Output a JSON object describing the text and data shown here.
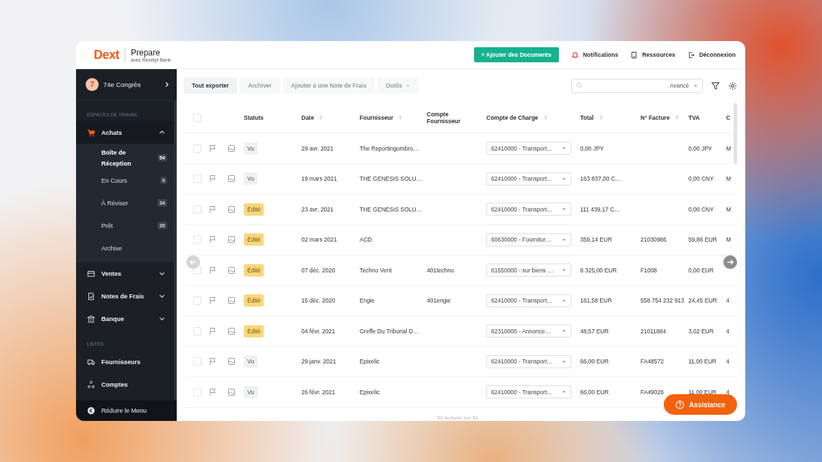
{
  "header": {
    "logo": "Dext",
    "product": "Prepare",
    "tagline": "avec Receipt Bank",
    "add_button": "+ Ajouter des Documents",
    "links": [
      {
        "label": "Notifications",
        "kind": "bell"
      },
      {
        "label": "Ressources",
        "kind": "doc"
      },
      {
        "label": "Déconnexion",
        "kind": "logout"
      }
    ]
  },
  "sidebar": {
    "workspace": {
      "badge": "7",
      "name": "74e Congrès"
    },
    "sections": [
      {
        "title": "ESPACES DE TRAVAIL",
        "items": [
          {
            "label": "Achats",
            "kind": "cart",
            "expanded": true,
            "children": [
              {
                "label": "Boîte de Réception",
                "count": "54",
                "selected": true
              },
              {
                "label": "En Cours",
                "count": "0",
                "selected": false
              },
              {
                "label": "À Réviser",
                "count": "34",
                "selected": false
              },
              {
                "label": "Prêt",
                "count": "20",
                "selected": false
              },
              {
                "label": "Archive",
                "selected": false
              }
            ]
          },
          {
            "label": "Ventes",
            "kind": "wallet",
            "expanded": false
          },
          {
            "label": "Notes de Frais",
            "kind": "receipt",
            "expanded": false
          },
          {
            "label": "Banque",
            "kind": "bank",
            "expanded": false
          }
        ]
      },
      {
        "title": "LISTES",
        "items": [
          {
            "label": "Fournisseurs",
            "kind": "truck"
          },
          {
            "label": "Comptes",
            "kind": "nodes"
          }
        ]
      }
    ],
    "collapse": "Réduire le Menu"
  },
  "toolbar": {
    "actions": [
      {
        "label": "Tout exporter",
        "disabled": false
      },
      {
        "label": "Archiver",
        "disabled": true
      },
      {
        "label": "Ajouter à une Note de Frais",
        "disabled": true
      },
      {
        "label": "Outils",
        "disabled": true,
        "dropdown": true
      }
    ],
    "search": {
      "advanced": "Avancé"
    }
  },
  "table": {
    "select_all": {
      "checked": false
    },
    "columns": [
      {
        "label": "Statuts",
        "sortable": false
      },
      {
        "label": "Date",
        "sortable": true
      },
      {
        "label": "Fournisseur",
        "sortable": true
      },
      {
        "label": "Compte Fournisseur",
        "sortable": false
      },
      {
        "label": "Compte de Charge",
        "sortable": true
      },
      {
        "label": "Total",
        "sortable": true
      },
      {
        "label": "N° Facture",
        "sortable": true
      },
      {
        "label": "TVA",
        "sortable": false
      },
      {
        "label": "C",
        "sortable": false
      }
    ],
    "rows": [
      {
        "checked": false,
        "status": "Vu",
        "kind": "seen",
        "date": "29 avr. 2021",
        "supplier": "The Reportingombro…",
        "expense_account": "62410000 - Transport…",
        "total": "0,00 JPY",
        "vat": "0,00 JPY",
        "column_9": "M"
      },
      {
        "checked": false,
        "status": "Vu",
        "kind": "seen",
        "date": "19 mars 2021",
        "supplier": "THE GENESIS SOLU…",
        "expense_account": "62410000 - Transport…",
        "total": "163 837,00 C…",
        "vat": "0,00 CNY",
        "column_9": "M"
      },
      {
        "checked": false,
        "status": "Édité",
        "kind": "edited",
        "date": "23 avr. 2021",
        "supplier": "THE GENESIS SOLU…",
        "expense_account": "62410000 - Transport…",
        "total": "111 439,17 C…",
        "vat": "0,00 CNY",
        "column_9": "M"
      },
      {
        "checked": false,
        "status": "Édité",
        "kind": "edited",
        "date": "02 mars 2021",
        "supplier": "ACD",
        "expense_account": "60630000 - Fournitur…",
        "total": "359,14 EUR",
        "invoice_no": "21030986",
        "vat": "59,86 EUR",
        "column_9": "M"
      },
      {
        "checked": false,
        "status": "Édité",
        "kind": "edited",
        "date": "07 déc. 2020",
        "supplier": "Techno Vent",
        "supplier_account": "401techno",
        "expense_account": "61550000 - sur biens …",
        "total": "8 325,00 EUR",
        "invoice_no": "F1008",
        "vat": "0,00 EUR"
      },
      {
        "checked": false,
        "status": "Édité",
        "kind": "edited",
        "date": "15 déc. 2020",
        "supplier": "Engie",
        "supplier_account": "401engie",
        "expense_account": "62410000 - Transport…",
        "total": "161,58 EUR",
        "invoice_no": "558 754 232 913",
        "vat": "24,45 EUR",
        "column_9": "4"
      },
      {
        "checked": false,
        "status": "Édité",
        "kind": "edited",
        "date": "04 févr. 2021",
        "supplier": "Greffe Du Tribunal D…",
        "expense_account": "62310000 - Annonce…",
        "total": "48,57 EUR",
        "invoice_no": "21011884",
        "vat": "3,02 EUR",
        "column_9": "4"
      },
      {
        "checked": false,
        "status": "Vu",
        "kind": "seen",
        "date": "29 janv. 2021",
        "supplier": "Epixelic",
        "expense_account": "62410000 - Transport…",
        "total": "66,00 EUR",
        "invoice_no": "FA48572",
        "vat": "11,00 EUR",
        "column_9": "4"
      },
      {
        "checked": false,
        "status": "Vu",
        "kind": "seen",
        "date": "26 févr. 2021",
        "supplier": "Epixelic",
        "expense_account": "62410000 - Transport…",
        "total": "66,00 EUR",
        "invoice_no": "FA49026",
        "vat": "11,00 EUR",
        "column_9": "4"
      }
    ],
    "footer": "50 factures sur 54"
  },
  "assistance": "Assistance"
}
